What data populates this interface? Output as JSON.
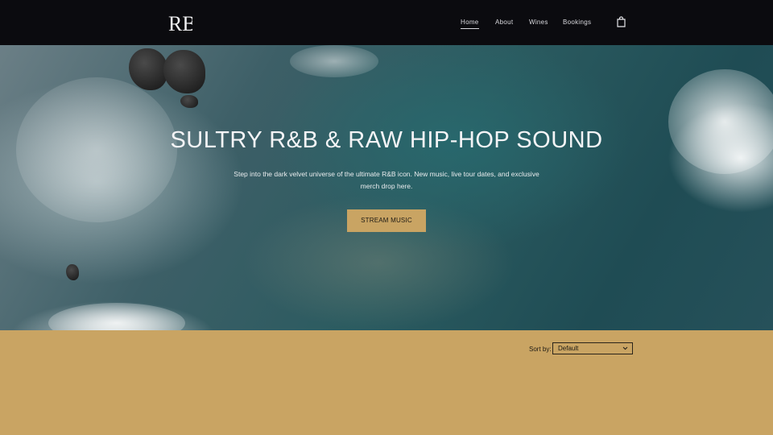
{
  "header": {
    "logo_text": "RB",
    "nav": [
      {
        "label": "Home",
        "active": true
      },
      {
        "label": "About",
        "active": false
      },
      {
        "label": "Wines",
        "active": false
      },
      {
        "label": "Bookings",
        "active": false
      }
    ],
    "cart_icon": "shopping-bag-icon"
  },
  "hero": {
    "title": "SULTRY R&B & RAW HIP-HOP SOUND",
    "subtitle": "Step into the dark velvet universe of the ultimate R&B icon. New music, live tour dates, and exclusive merch drop here.",
    "cta_label": "STREAM MUSIC"
  },
  "sort": {
    "label": "Sort by:",
    "selected": "Default"
  },
  "colors": {
    "header_bg": "#0b0b0f",
    "accent": "#c9a463",
    "text_light": "#f4f4f6"
  }
}
